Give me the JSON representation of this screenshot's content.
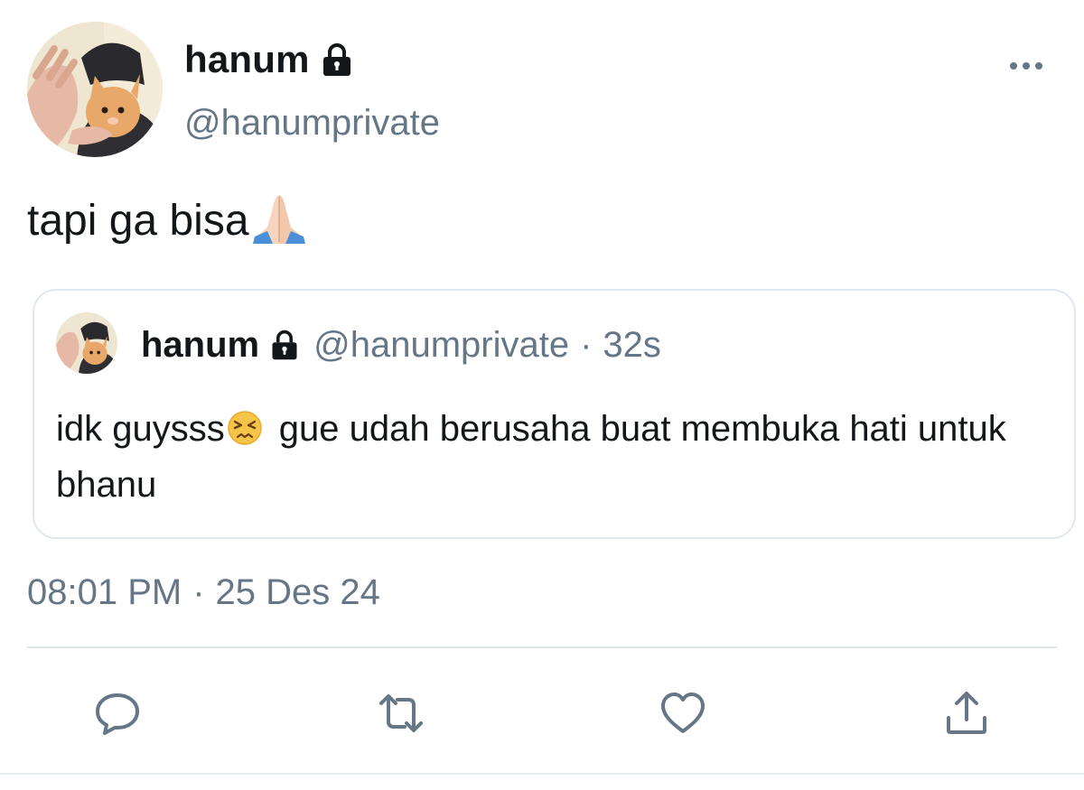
{
  "author": {
    "display_name": "hanum",
    "handle": "@hanumprivate",
    "protected_icon": "lock-icon",
    "avatar": "kitten-avatar"
  },
  "tweet": {
    "text": "tapi ga bisa",
    "trailing_emoji": "folded-hands-emoji",
    "time": "08:01 PM",
    "separator": "·",
    "date": "25 Des 24"
  },
  "quoted_tweet": {
    "display_name": "hanum",
    "handle": "@hanumprivate",
    "separator": "·",
    "relative_time": "32s",
    "text_before_emoji": "idk guysss",
    "emoji": "persevering-face-emoji",
    "text_after_emoji": "gue udah berusaha buat membuka hati untuk bhanu"
  },
  "actions": {
    "reply_icon": "reply-icon",
    "retweet_icon": "retweet-icon",
    "like_icon": "heart-icon",
    "share_icon": "share-icon",
    "more_icon": "more-dots-icon"
  },
  "colors": {
    "text_primary": "#14171a",
    "text_secondary": "#657786",
    "border": "#e1e8ed",
    "icon": "#657786"
  }
}
